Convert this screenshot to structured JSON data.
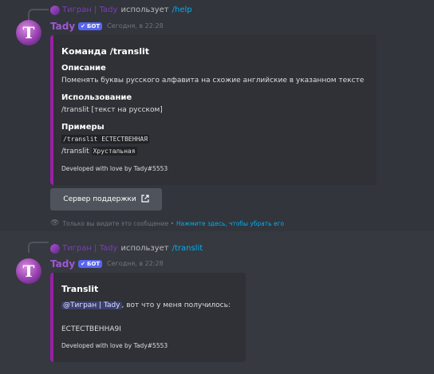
{
  "messages": [
    {
      "reply": {
        "name": "Тигран | Tady",
        "text": "использует",
        "command": "/help"
      },
      "author": "Tady",
      "bot_badge": "БОТ",
      "timestamp": "Сегодня, в 22:28",
      "embed": {
        "title": "Команда /translit",
        "fields": [
          {
            "name": "Описание",
            "value": "Поменять буквы русского алфавита на схожие английские в указанном тексте"
          },
          {
            "name": "Использование",
            "value": "/translit [текст на русском]"
          },
          {
            "name": "Примеры",
            "examples": [
              {
                "cmd": "/translit",
                "arg": "ЕСТЕСТВЕННАЯ"
              },
              {
                "cmd": "/translit",
                "arg": "Хрустальная"
              }
            ]
          }
        ],
        "footer": "Developed with love by Tady#5553"
      },
      "button": {
        "label": "Сервер поддержки",
        "icon": "external-link-icon"
      },
      "ephemeral": {
        "text": "Только вы видите это сообщение •",
        "link": "Нажмите здесь, чтобы убрать его"
      }
    },
    {
      "reply": {
        "name": "Тигран | Tady",
        "text": "использует",
        "command": "/translit"
      },
      "author": "Tady",
      "bot_badge": "БОТ",
      "timestamp": "Сегодня, в 22:28",
      "embed": {
        "title": "Translit",
        "mention": "@Тигран | Tady",
        "description": ", вот что у меня получилось:",
        "result": "ЕCTECTBEHHA9I",
        "footer": "Developed with love by Tady#5553"
      }
    }
  ],
  "colors": {
    "embed_border": "#9b1fa8",
    "username": "#9b59d0",
    "link": "#00aff4",
    "badge": "#5865f2"
  }
}
